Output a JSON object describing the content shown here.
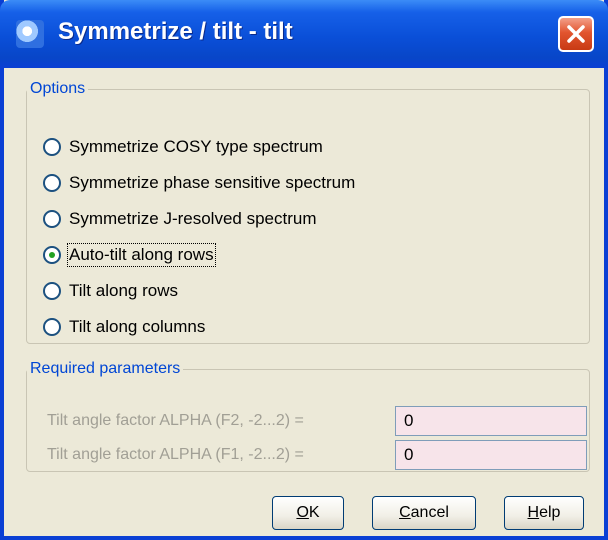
{
  "window": {
    "title": "Symmetrize / tilt - tilt",
    "app_icon": "app-logo-icon",
    "close_icon": "close-icon",
    "close_color": "#e2552f",
    "titlebar_color": "#0a4fd8"
  },
  "options": {
    "legend": "Options",
    "selected_index": 3,
    "items": [
      {
        "label": "Symmetrize COSY type spectrum",
        "checked": false
      },
      {
        "label": "Symmetrize phase sensitive spectrum",
        "checked": false
      },
      {
        "label": "Symmetrize J-resolved spectrum",
        "checked": false
      },
      {
        "label": "Auto-tilt along rows",
        "checked": true
      },
      {
        "label": "Tilt along rows",
        "checked": false
      },
      {
        "label": "Tilt along columns",
        "checked": false
      }
    ]
  },
  "params": {
    "legend": "Required parameters",
    "rows": [
      {
        "label": "Tilt angle factor ALPHA (F2, -2...2) =",
        "value": "0"
      },
      {
        "label": "Tilt angle factor ALPHA (F1, -2...2) =",
        "value": "0"
      }
    ]
  },
  "buttons": {
    "ok": {
      "mnemonic": "O",
      "rest": "K"
    },
    "cancel": {
      "mnemonic": "C",
      "rest": "ancel"
    },
    "help": {
      "mnemonic": "H",
      "rest": "elp"
    }
  }
}
